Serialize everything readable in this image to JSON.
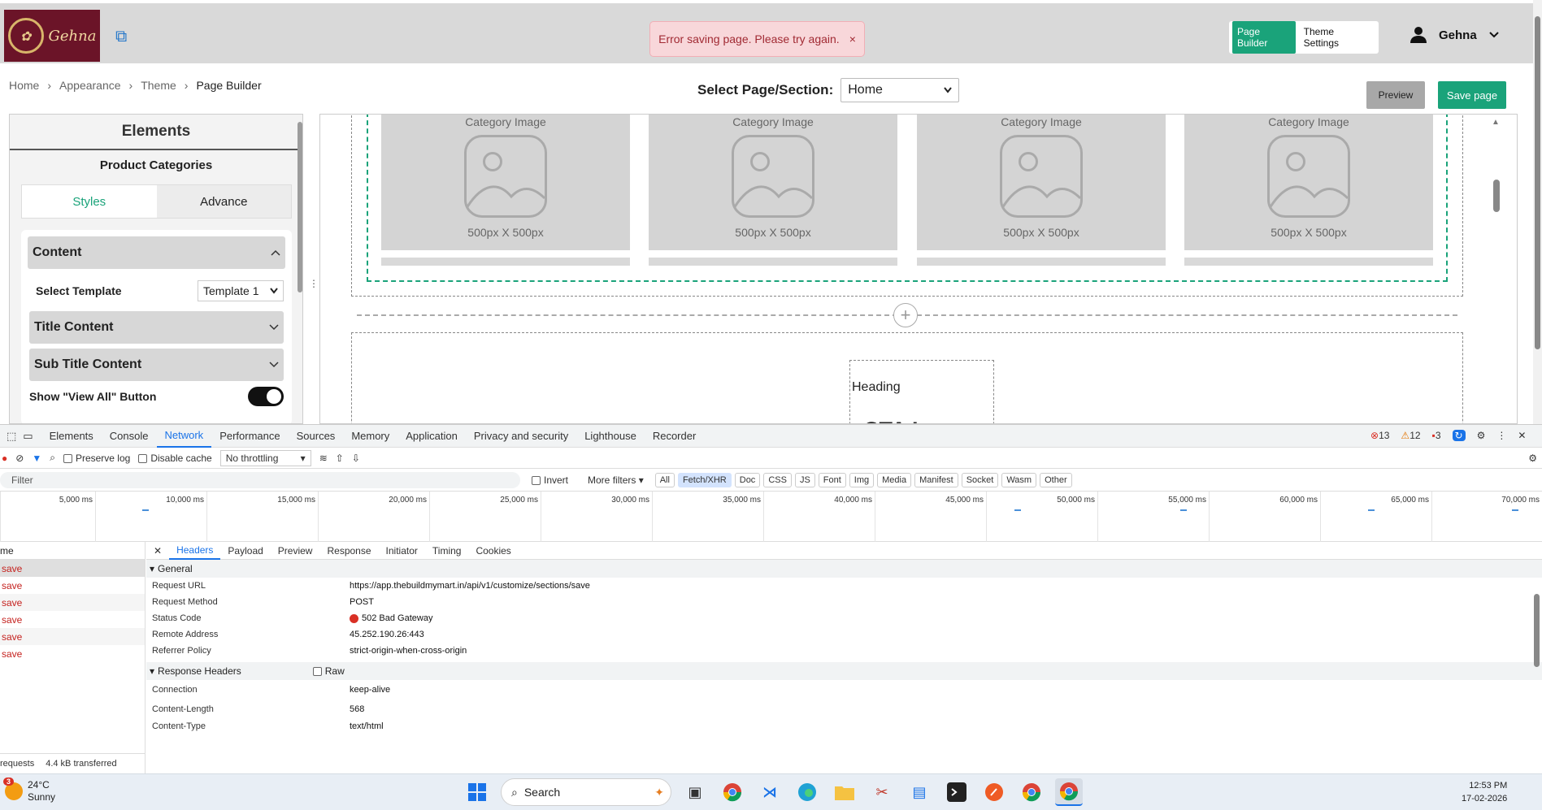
{
  "header": {
    "logo_text": "Gehna",
    "toast": {
      "message": "Error saving page. Please try again.",
      "close": "×"
    },
    "segmented": {
      "active": "Page Builder",
      "other": "Theme Settings"
    },
    "user_name": "Gehna"
  },
  "breadcrumb": [
    {
      "label": "Home"
    },
    {
      "label": "Appearance"
    },
    {
      "label": "Theme"
    },
    {
      "label": "Page Builder"
    }
  ],
  "page_select": {
    "label": "Select Page/Section:",
    "value": "Home"
  },
  "actions": {
    "preview": "Preview",
    "save": "Save page"
  },
  "elements_panel": {
    "title": "Elements",
    "subtitle": "Product Categories",
    "tabs": {
      "styles": "Styles",
      "advance": "Advance"
    },
    "content_header": "Content",
    "select_template_label": "Select Template",
    "select_template_value": "Template 1",
    "title_content": "Title Content",
    "subtitle_content": "Sub Title Content",
    "view_all_label": "Show \"View All\" Button",
    "view_all_on": true
  },
  "canvas": {
    "cards": [
      {
        "caption": "Category Image",
        "dims": "500px X 500px"
      },
      {
        "caption": "Category Image",
        "dims": "500px X 500px"
      },
      {
        "caption": "Category Image",
        "dims": "500px X 500px"
      },
      {
        "caption": "Category Image",
        "dims": "500px X 500px"
      }
    ],
    "add_symbol": "+",
    "heading": "Heading",
    "cta_image": "CTA Image"
  },
  "devtools": {
    "tabs": [
      "Elements",
      "Console",
      "Network",
      "Performance",
      "Sources",
      "Memory",
      "Application",
      "Privacy and security",
      "Lighthouse",
      "Recorder"
    ],
    "active_tab": "Network",
    "errors": "13",
    "warnings": "12",
    "issues": "3",
    "toolbar": {
      "preserve_log": "Preserve log",
      "disable_cache": "Disable cache",
      "throttling": "No throttling"
    },
    "filter": {
      "placeholder": "Filter",
      "invert": "Invert",
      "more_filters": "More filters"
    },
    "type_chips": [
      "All",
      "Fetch/XHR",
      "Doc",
      "CSS",
      "JS",
      "Font",
      "Img",
      "Media",
      "Manifest",
      "Socket",
      "Wasm",
      "Other"
    ],
    "active_chip": "Fetch/XHR",
    "timeline_ticks": [
      "5,000 ms",
      "10,000 ms",
      "15,000 ms",
      "20,000 ms",
      "25,000 ms",
      "30,000 ms",
      "35,000 ms",
      "40,000 ms",
      "45,000 ms",
      "50,000 ms",
      "55,000 ms",
      "60,000 ms",
      "65,000 ms",
      "70,000 ms"
    ],
    "request_list": {
      "header": "me",
      "items": [
        "save",
        "save",
        "save",
        "save",
        "save",
        "save"
      ],
      "footer_requests": "requests",
      "footer_transferred": "4.4 kB transferred"
    },
    "detail_tabs": [
      "Headers",
      "Payload",
      "Preview",
      "Response",
      "Initiator",
      "Timing",
      "Cookies"
    ],
    "active_detail_tab": "Headers",
    "general": {
      "title": "General",
      "rows": [
        {
          "k": "Request URL",
          "v": "https://app.thebuildmymart.in/api/v1/customize/sections/save"
        },
        {
          "k": "Request Method",
          "v": "POST"
        },
        {
          "k": "Status Code",
          "v": "502 Bad Gateway"
        },
        {
          "k": "Remote Address",
          "v": "45.252.190.26:443"
        },
        {
          "k": "Referrer Policy",
          "v": "strict-origin-when-cross-origin"
        }
      ]
    },
    "response_headers": {
      "title": "Response Headers",
      "raw": "Raw",
      "rows": [
        {
          "k": "Connection",
          "v": "keep-alive"
        },
        {
          "k": "Content-Length",
          "v": "568"
        },
        {
          "k": "Content-Type",
          "v": "text/html"
        }
      ]
    }
  },
  "taskbar": {
    "temp": "24°C",
    "condition": "Sunny",
    "weather_badge": "3",
    "search": "Search",
    "time": "12:53 PM",
    "date": "17-02-2026"
  }
}
